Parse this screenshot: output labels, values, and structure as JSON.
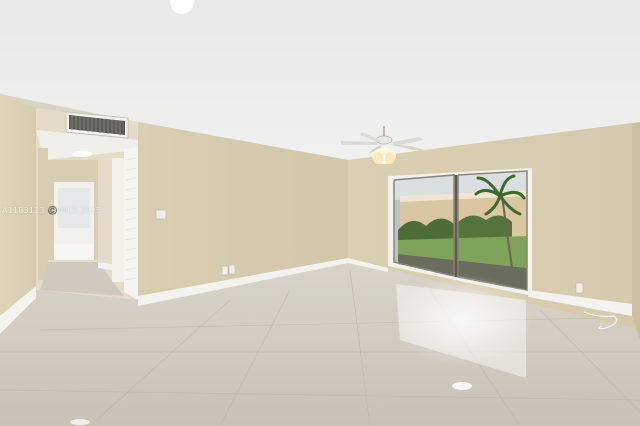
{
  "photo": {
    "watermark": "A1183113 ©️ MLS 2025",
    "colors": {
      "ceiling": "#ebebea",
      "wall": "#dccfb2",
      "floor": "#d3cdc2",
      "baseboard": "#f4f2ee",
      "lawn": "#7fa35b"
    }
  }
}
